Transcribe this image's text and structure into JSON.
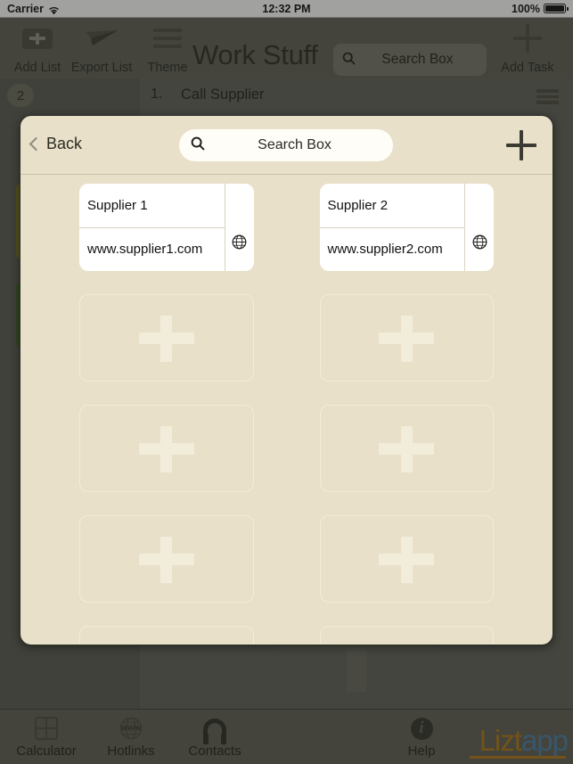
{
  "status_bar": {
    "carrier": "Carrier",
    "wifi_icon": "wifi-icon",
    "time": "12:32 PM",
    "battery_percent": "100%",
    "battery_icon": "battery-full-icon"
  },
  "toolbar": {
    "add_list": {
      "label": "Add List",
      "icon": "add-list-icon"
    },
    "export_list": {
      "label": "Export List",
      "icon": "paper-plane-icon"
    },
    "theme": {
      "label": "Theme",
      "icon": "hamburger-lines-icon"
    },
    "title": "Work Stuff",
    "search": {
      "placeholder": "Search Box",
      "value": "",
      "icon": "search-icon"
    },
    "add_task": {
      "label": "Add Task",
      "icon": "plus-icon"
    }
  },
  "background": {
    "list_count_badge": "2",
    "task_number": "1.",
    "task_name": "Call Supplier",
    "task_menu_icon": "hamburger-menu-icon",
    "add_placeholder_icon": "plus-icon"
  },
  "modal": {
    "back_label": "Back",
    "back_icon": "chevron-left-icon",
    "search": {
      "placeholder": "Search Box",
      "value": "",
      "icon": "search-icon"
    },
    "add_icon": "plus-icon",
    "cards": [
      {
        "type": "filled",
        "name": "Supplier 1",
        "url": "www.supplier1.com",
        "icon": "globe-icon"
      },
      {
        "type": "filled",
        "name": "Supplier 2",
        "url": "www.supplier2.com",
        "icon": "globe-icon"
      },
      {
        "type": "empty",
        "icon": "plus-icon"
      },
      {
        "type": "empty",
        "icon": "plus-icon"
      },
      {
        "type": "empty",
        "icon": "plus-icon"
      },
      {
        "type": "empty",
        "icon": "plus-icon"
      },
      {
        "type": "empty",
        "icon": "plus-icon"
      },
      {
        "type": "empty",
        "icon": "plus-icon"
      },
      {
        "type": "empty",
        "icon": "plus-icon"
      },
      {
        "type": "empty",
        "icon": "plus-icon"
      }
    ]
  },
  "tabbar": {
    "items": [
      {
        "label": "Calculator",
        "icon": "calculator-icon"
      },
      {
        "label": "Hotlinks",
        "icon": "globe-www-icon"
      },
      {
        "label": "Contacts",
        "icon": "headset-icon"
      },
      {
        "label": "Help",
        "icon": "info-icon"
      }
    ],
    "brand": {
      "part1": "Lizt",
      "part2": "app"
    }
  },
  "colors": {
    "modal_bg": "#e8e0c8",
    "toolbar_bg": "#5f5f56",
    "brand_orange": "#b07818",
    "brand_blue": "#4a7fa5",
    "chip_olive": "#7a7424",
    "chip_green": "#3f6023"
  }
}
